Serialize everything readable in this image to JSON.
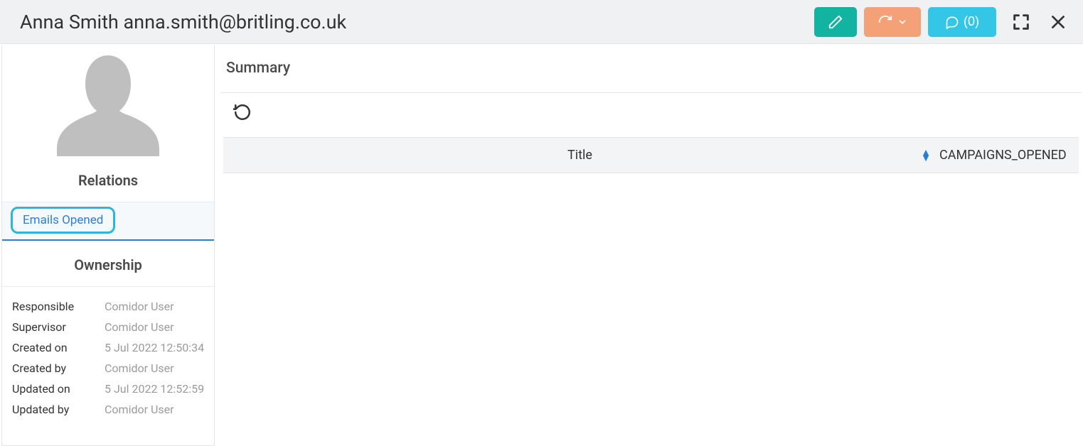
{
  "header": {
    "title": "Anna Smith anna.smith@britling.co.uk",
    "comments_label": "(0)"
  },
  "sidebar": {
    "relations_title": "Relations",
    "relation_item": "Emails Opened",
    "ownership_title": "Ownership",
    "ownership": [
      {
        "label": "Responsible",
        "value": "Comidor User"
      },
      {
        "label": "Supervisor",
        "value": "Comidor User"
      },
      {
        "label": "Created on",
        "value": "5 Jul 2022 12:50:34"
      },
      {
        "label": "Created by",
        "value": "Comidor User"
      },
      {
        "label": "Updated on",
        "value": "5 Jul 2022 12:52:59"
      },
      {
        "label": "Updated by",
        "value": "Comidor User"
      }
    ]
  },
  "main": {
    "summary_title": "Summary",
    "columns": {
      "title": "Title",
      "campaigns_opened": "CAMPAIGNS_OPENED"
    }
  }
}
